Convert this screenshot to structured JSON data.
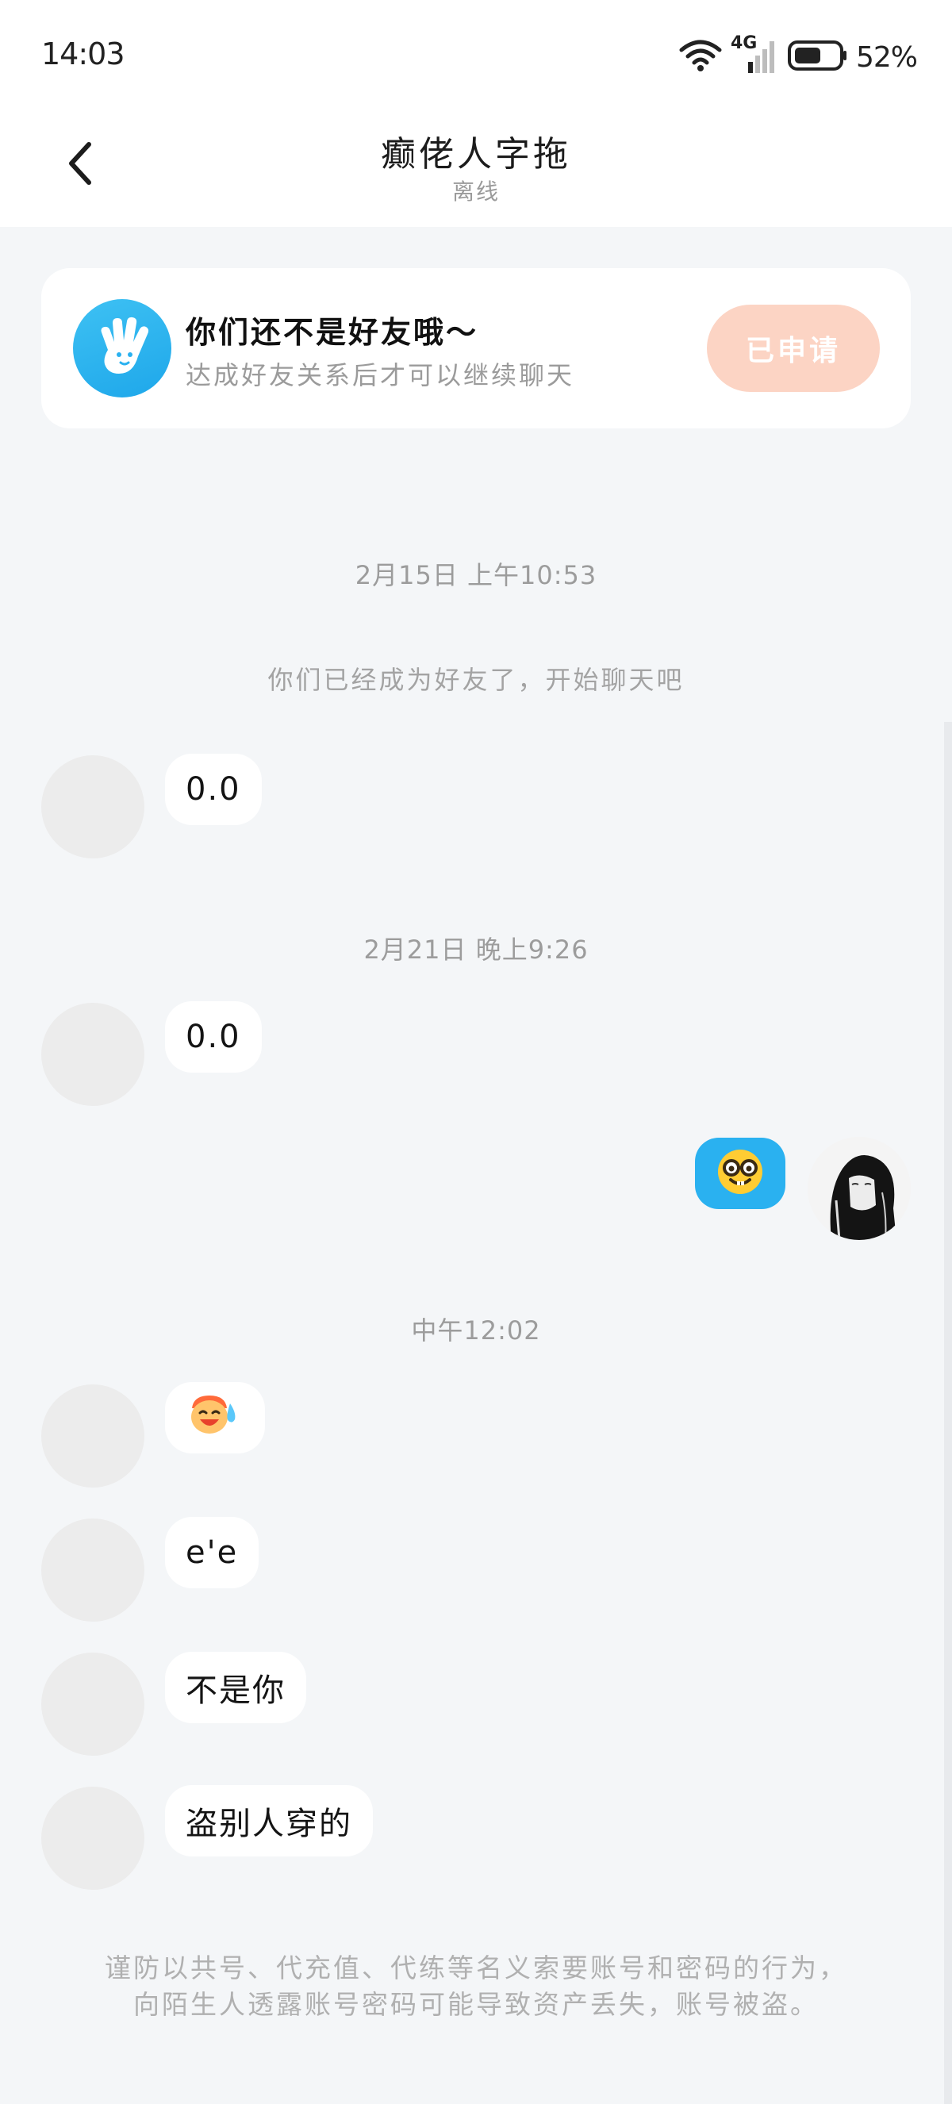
{
  "status_bar": {
    "time": "14:03",
    "network": "4G",
    "battery": "52%",
    "icons": [
      "wifi-icon",
      "signal-icon",
      "battery-icon"
    ]
  },
  "header": {
    "title": "癫佬人字拖",
    "subtitle": "离线",
    "back_icon": "chevron-left-icon"
  },
  "friend_banner": {
    "title": "你们还不是好友哦～",
    "description": "达成好友关系后才可以继续聊天",
    "button_label": "已申请",
    "icon": "hand-wave-icon"
  },
  "messages": {
    "divider_1": "2月15日 上午10:53",
    "system_1": "你们已经成为好友了，开始聊天吧",
    "msg_1": "0.0",
    "divider_2": "2月21日 晚上9:26",
    "msg_2": "0.0",
    "outgoing_emoji": "nerd-face-emoji",
    "divider_3": "中午12:02",
    "msg_3_emoji": "laughing-tears-sticker",
    "msg_4": "e'e",
    "msg_5": "不是你",
    "msg_6": "盗别人穿的"
  },
  "footer_warning": "谨防以共号、代充值、代练等名义索要账号和密码的行为，向陌生人透露账号密码可能导致资产丢失，账号被盗。",
  "colors": {
    "background": "#f4f6f8",
    "accent_blue": "#2ab1f0",
    "applied_button": "#fcd4c4",
    "bubble_in": "#ffffff"
  }
}
